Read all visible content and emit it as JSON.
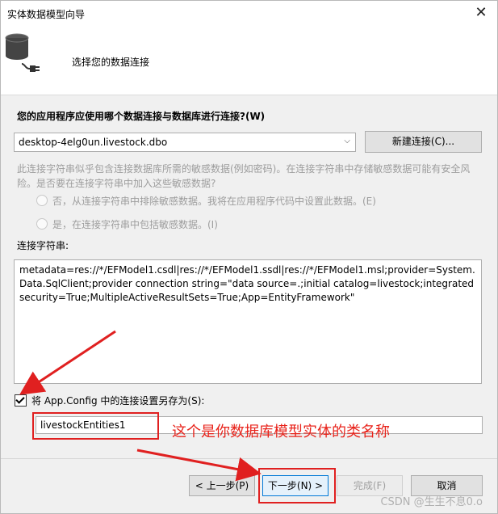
{
  "window": {
    "title": "实体数据模型向导",
    "close_label": "✕"
  },
  "header": {
    "title": "选择您的数据连接",
    "icon": "database-plug-icon"
  },
  "connection": {
    "question": "您的应用程序应使用哪个数据连接与数据库进行连接?(W)",
    "selected": "desktop-4elg0un.livestock.dbo",
    "arrow": "⌵",
    "new_button": "新建连接(C)..."
  },
  "sensitive": {
    "warning": "此连接字符串似乎包含连接数据库所需的敏感数据(例如密码)。在连接字符串中存储敏感数据可能有安全风险。是否要在连接字符串中加入这些敏感数据?",
    "option_no": "否，从连接字符串中排除敏感数据。我将在应用程序代码中设置此数据。(E)",
    "option_yes": "是，在连接字符串中包括敏感数据。(I)"
  },
  "connection_string": {
    "label": "连接字符串:",
    "value": "metadata=res://*/EFModel1.csdl|res://*/EFModel1.ssdl|res://*/EFModel1.msl;provider=System.Data.SqlClient;provider connection string=\"data source=.;initial catalog=livestock;integrated security=True;MultipleActiveResultSets=True;App=EntityFramework\""
  },
  "save": {
    "checked": true,
    "label": "将 App.Config 中的连接设置另存为(S):",
    "entity_name": "livestockEntities1"
  },
  "annotation": {
    "text": "这个是你数据库模型实体的类名称"
  },
  "footer": {
    "prev": "< 上一步(P)",
    "next": "下一步(N) >",
    "finish": "完成(F)",
    "cancel": "取消"
  },
  "watermark": "CSDN @生生不息0.o",
  "colors": {
    "annotation_red": "#e02020",
    "focus_blue": "#0078d7"
  }
}
